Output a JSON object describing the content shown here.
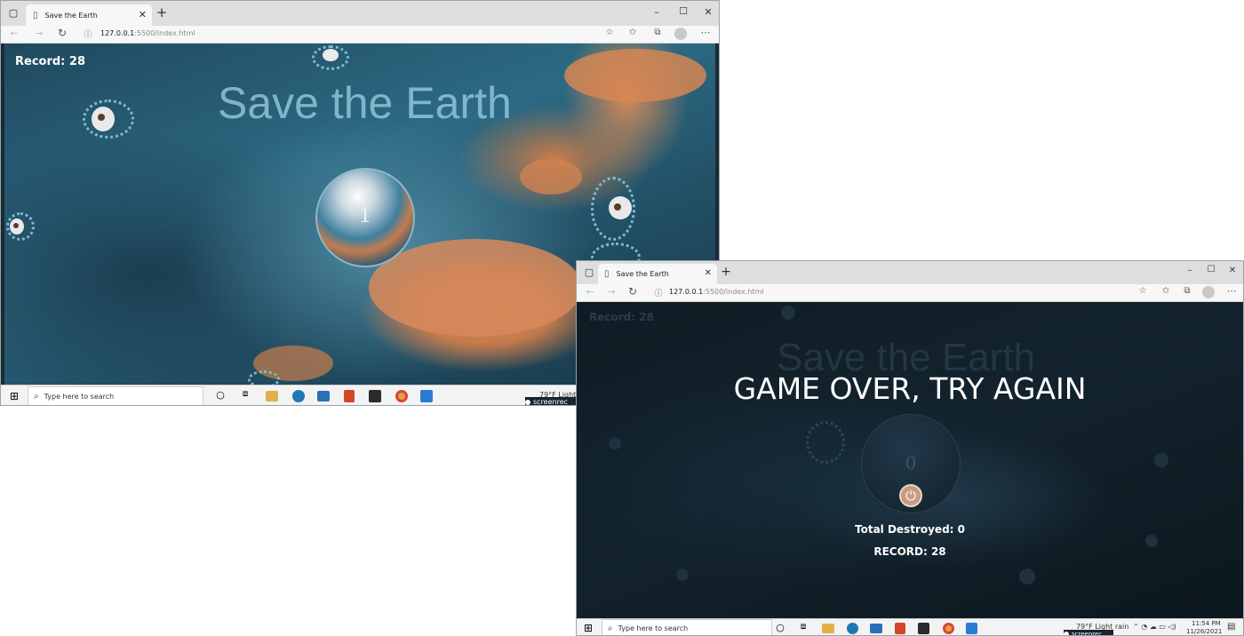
{
  "windows": [
    {
      "tab_title": "Save the Earth",
      "address": {
        "host": "127.0.0.1",
        "port": ":5500",
        "path": "/index.html"
      },
      "game": {
        "record_label": "Record: 28",
        "title": "Save the Earth",
        "earth_counter": "1"
      },
      "taskbar": {
        "search_placeholder": "Type here to search",
        "weather": "79°F  Light",
        "recorder": "screenrec"
      }
    },
    {
      "tab_title": "Save the Earth",
      "address": {
        "host": "127.0.0.1",
        "port": ":5500",
        "path": "/index.html"
      },
      "game": {
        "record_label": "Record: 28",
        "title": "Save the Earth",
        "earth_counter": "0",
        "game_over": "GAME OVER, TRY AGAIN",
        "total_destroyed": "Total Destroyed: 0",
        "record_summary": "RECORD: 28"
      },
      "taskbar": {
        "search_placeholder": "Type here to search",
        "weather": "79°F  Light rain",
        "recorder": "screenrec",
        "time": "11:54 PM",
        "date": "11/26/2021"
      }
    }
  ],
  "icons": {
    "browser": [
      "tab-actions-icon",
      "page-icon",
      "close-tab-icon",
      "new-tab-icon",
      "minimize-icon",
      "maximize-icon",
      "close-window-icon",
      "back-icon",
      "forward-icon",
      "refresh-icon",
      "info-icon",
      "reader-icon",
      "favorite-icon",
      "collections-icon",
      "profile-icon",
      "more-icon"
    ],
    "taskbar": [
      "windows-start-icon",
      "search-icon",
      "cortana-icon",
      "task-view-icon",
      "file-explorer-icon",
      "edge-icon",
      "mail-icon",
      "office-icon",
      "sticky-notes-icon",
      "chrome-icon",
      "vscode-icon"
    ]
  },
  "colors": {
    "title_glass": "#8fc3d8",
    "game_over_text": "#ffffff",
    "space_dark": "#0f1c24",
    "nebula_orange": "#d88a5a"
  }
}
